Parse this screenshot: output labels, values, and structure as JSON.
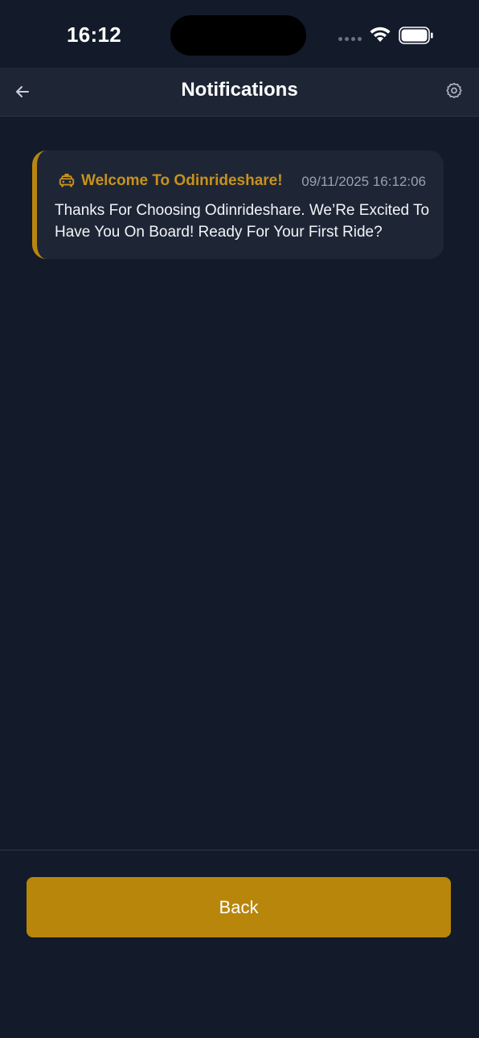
{
  "status_bar": {
    "time": "16:12"
  },
  "header": {
    "title": "Notifications",
    "back_icon": "arrow-left-icon",
    "settings_icon": "gear-icon"
  },
  "notifications": [
    {
      "icon": "taxi-icon",
      "title": "Welcome To Odinrideshare!",
      "timestamp": "09/11/2025 16:12:06",
      "body": "Thanks For Choosing Odinrideshare. We’Re Excited To Have You On Board! Ready For Your First Ride?"
    }
  ],
  "footer": {
    "back_label": "Back"
  },
  "colors": {
    "background": "#131a29",
    "card": "#1e2636",
    "accent": "#b8860b",
    "title_accent": "#c8921a"
  }
}
